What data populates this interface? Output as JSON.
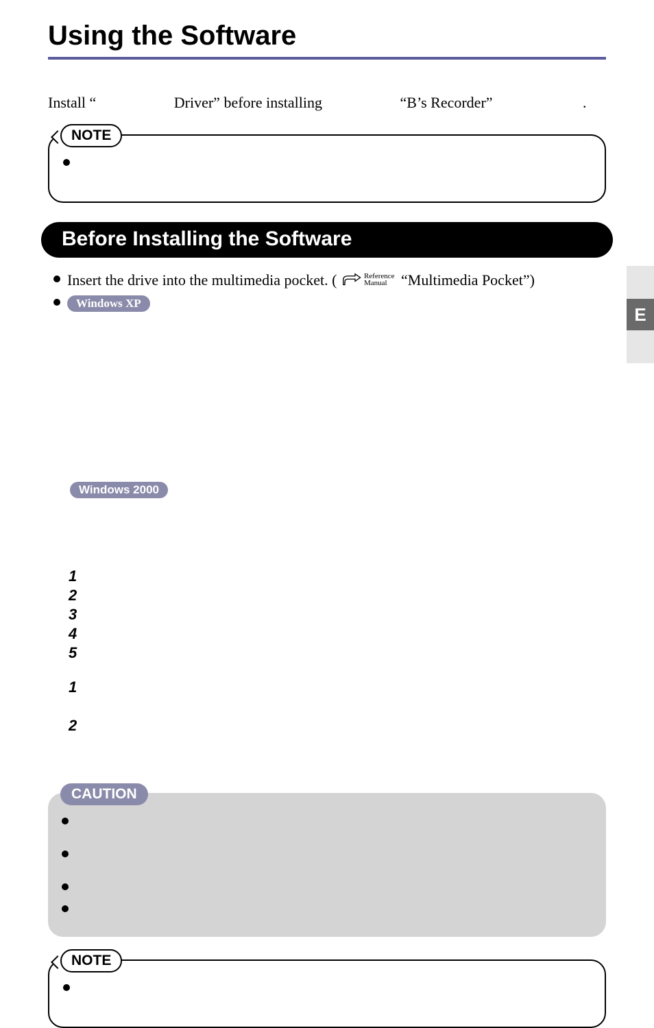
{
  "title": "Using the Software",
  "intro": {
    "prefix": "Install “",
    "mid1": "Driver” before installing",
    "mid2": "“B’s Recorder”",
    "suffix": "."
  },
  "noteLabel": "NOTE",
  "sectionHeading": "Before Installing the Software",
  "bullet1": {
    "pre": "Insert the drive into the multimedia pocket. (",
    "refTop": "Reference",
    "refBot": "Manual",
    "post": " “Multimedia Pocket”)"
  },
  "osXP": "Windows XP",
  "os2000": "Windows 2000",
  "stepsA": [
    "1",
    "2",
    "3",
    "4",
    "5"
  ],
  "stepsB": [
    "1",
    "2"
  ],
  "cautionLabel": "CAUTION",
  "edgeTab": "E"
}
